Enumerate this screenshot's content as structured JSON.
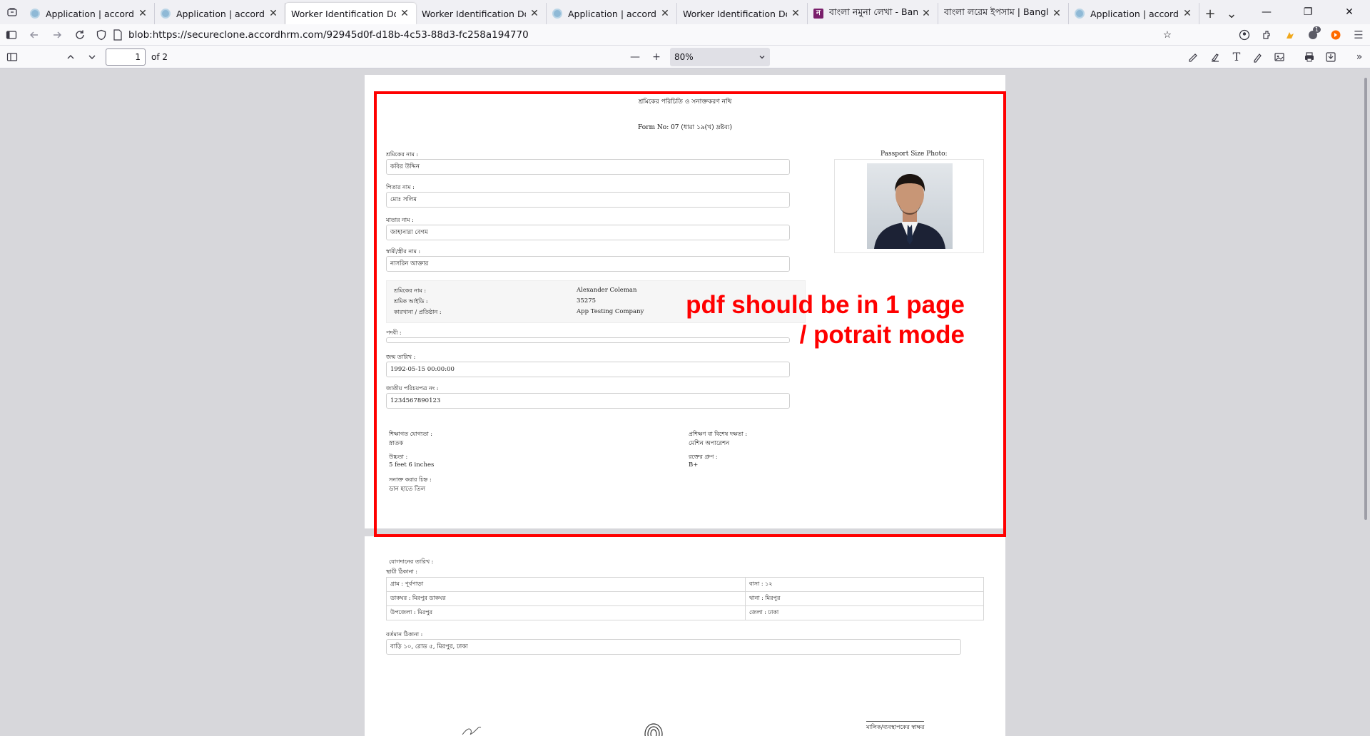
{
  "tabs": [
    {
      "title": "Application | accordHRM",
      "favicon": "globe-icon",
      "active": false
    },
    {
      "title": "Application | accordHRM",
      "favicon": "globe-icon",
      "active": false
    },
    {
      "title": "Worker Identification Document",
      "favicon": "none",
      "active": true
    },
    {
      "title": "Worker Identification Document",
      "favicon": "none",
      "active": false
    },
    {
      "title": "Application | accordHRM",
      "favicon": "globe-icon",
      "active": false
    },
    {
      "title": "Worker Identification Document",
      "favicon": "none",
      "active": false
    },
    {
      "title": "বাংলা নমুনা লেখা - Bangla",
      "favicon": "letter-n-icon",
      "active": false
    },
    {
      "title": "বাংলা লরেম ইপসাম | Bangla",
      "favicon": "none",
      "active": false
    },
    {
      "title": "Application | accordHRM",
      "favicon": "globe-icon",
      "active": false
    }
  ],
  "tab_new_label": "+",
  "tab_list_label": "⌄",
  "url": "blob:https://secureclone.accordhrm.com/92945d0f-d18b-4c53-88d3-fc258a194770",
  "extension_badge": "1",
  "pdf_toolbar": {
    "page_number": "1",
    "page_count": "of 2",
    "zoom": "80%"
  },
  "document": {
    "header_title": "শ্রমিকের পরিচিতি ও সনাক্তকরণ নথি",
    "form_no": "Form No: 07 (ধারা ১৯(খ) দ্রষ্টব্য)",
    "photo_label": "Passport Size Photo:",
    "fields": [
      {
        "label": "শ্রমিকের নাম :",
        "value": "কবির উদ্দিন"
      },
      {
        "label": "পিতার নাম :",
        "value": "মোঃ সলিম"
      },
      {
        "label": "মাতার নাম :",
        "value": "জাহানারা বেগম"
      },
      {
        "label": "স্বামী/স্ত্রীর নাম :",
        "value": "নাসরিন আক্তার"
      }
    ],
    "info_box": {
      "rows": [
        {
          "label": "শ্রমিকের নাম :",
          "value": "Alexander Coleman"
        },
        {
          "label": "শ্রমিক আইডি :",
          "value": "35275"
        },
        {
          "label": "কারখানা / প্রতিষ্ঠান :",
          "value": "App Testing Company"
        }
      ]
    },
    "designation": {
      "label": "পদবী :",
      "value": ""
    },
    "dob": {
      "label": "জন্ম তারিখ :",
      "value": "1992-05-15 00:00:00"
    },
    "nid": {
      "label": "জাতীয় পরিচয়পত্র নং :",
      "value": "1234567890123"
    },
    "details": {
      "education_label": "শিক্ষাগত যোগ্যতা :",
      "education_value": "স্নাতক",
      "training_label": "প্রশিক্ষণ বা বিশেষ দক্ষতা :",
      "training_value": "মেশিন অপারেশন",
      "height_label": "উচ্চতা :",
      "height_value": "5 feet 6 inches",
      "blood_label": "রক্তের গ্রুপ :",
      "blood_value": "B+",
      "mark_label": "সনাক্ত করার চিহ্ন :",
      "mark_value": "ডান হাতে তিল"
    },
    "page2": {
      "join_date_label": "যোগদানের তারিখ :",
      "permanent_address_label": "স্থায়ী ঠিকানা :",
      "address_rows": [
        [
          "গ্রাম : পূর্বপাড়া",
          "বাসা : ১২"
        ],
        [
          "ডাকঘর : মিরপুর ডাকঘর",
          "থানা : মিরপুর"
        ],
        [
          "উপজেলা : মিরপুর",
          "জেলা : ঢাকা"
        ]
      ],
      "present_address_label": "বর্তমান ঠিকানা :",
      "present_address_value": "বাড়ি ১০, রোড ৫, মিরপুর, ঢাকা",
      "signature_label": "মালিক/ব্যবস্থাপকের স্বাক্ষর"
    }
  },
  "annotation": {
    "line1": "pdf should be in 1 page",
    "line2": "/ potrait mode",
    "color": "#ff0000"
  }
}
